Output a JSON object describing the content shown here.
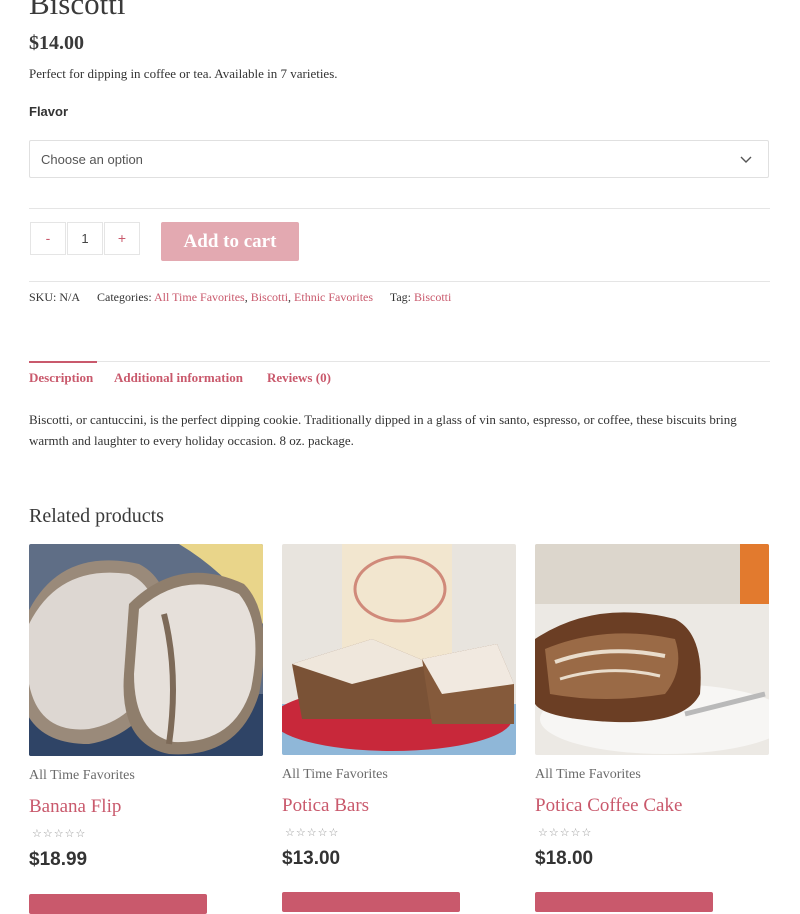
{
  "product": {
    "title": "Biscotti",
    "price": "$14.00",
    "short_description": "Perfect for dipping in coffee or tea. Available in 7 varieties.",
    "flavor_label": "Flavor",
    "flavor_select": {
      "selected": "Choose an option"
    },
    "quantity": {
      "minus_label": "-",
      "value": "1",
      "plus_label": "+"
    },
    "add_to_cart_label": "Add to cart",
    "meta": {
      "sku_label": "SKU:",
      "sku_value": "N/A",
      "categories_label": "Categories:",
      "categories": [
        "All Time Favorites",
        "Biscotti",
        "Ethnic Favorites"
      ],
      "tag_label": "Tag:",
      "tags": [
        "Biscotti"
      ]
    }
  },
  "tabs": [
    {
      "label": "Description",
      "active": true
    },
    {
      "label": "Additional information",
      "active": false
    },
    {
      "label": "Reviews (0)",
      "active": false
    }
  ],
  "description_text": "Biscotti, or cantuccini, is the perfect dipping cookie. Traditionally dipped in a glass of vin santo, espresso, or coffee, these biscuits bring warmth and laughter to every holiday occasion. 8 oz. package.",
  "related": {
    "title": "Related products",
    "products": [
      {
        "category": "All Time Favorites",
        "name": "Banana Flip",
        "price": "$18.99",
        "rating": "☆☆☆☆☆",
        "image_icon": "banana-flip-photo"
      },
      {
        "category": "All Time Favorites",
        "name": "Potica Bars",
        "price": "$13.00",
        "rating": "☆☆☆☆☆",
        "image_icon": "potica-bars-photo"
      },
      {
        "category": "All Time Favorites",
        "name": "Potica Coffee Cake",
        "price": "$18.00",
        "rating": "☆☆☆☆☆",
        "image_icon": "potica-coffee-cake-photo"
      }
    ]
  },
  "colors": {
    "accent": "#c9596c",
    "button_disabled": "#e3a9b1",
    "text": "#333333"
  }
}
